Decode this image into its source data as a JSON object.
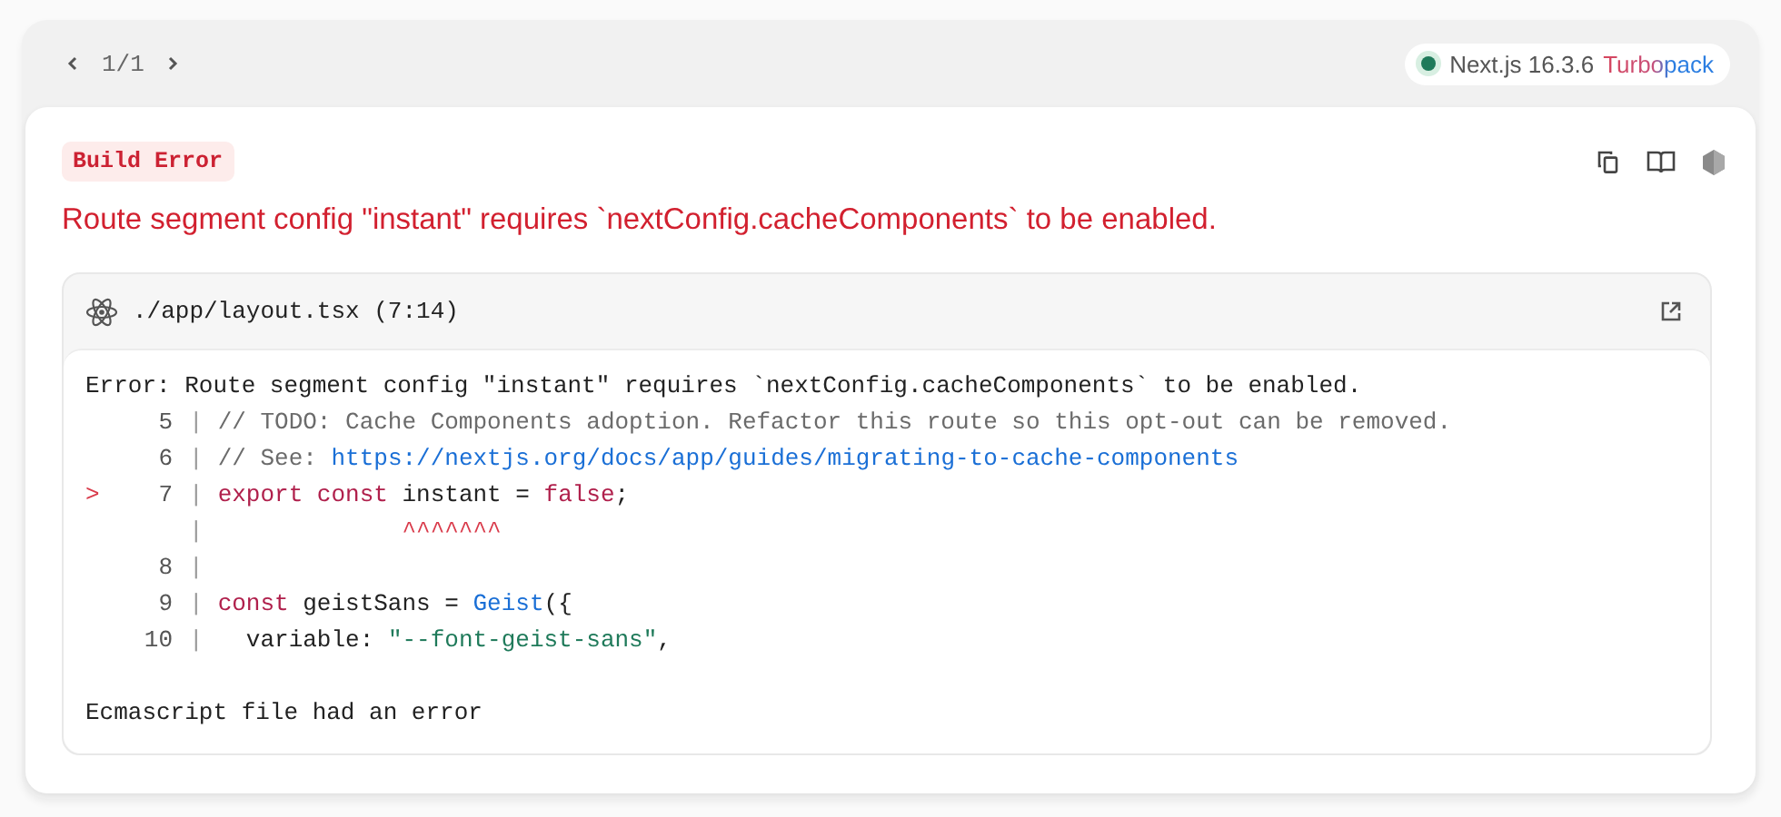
{
  "pager": {
    "label": "1/1",
    "prev_disabled": false,
    "next_disabled": false
  },
  "version_badge": {
    "version": "Next.js 16.3.6",
    "bundler": "Turbopack"
  },
  "error": {
    "badge": "Build Error",
    "title": "Route segment config \"instant\" requires `nextConfig.cacheComponents` to be enabled."
  },
  "code_frame": {
    "file": "./app/layout.tsx (7:14)",
    "message": "Error: Route segment config \"instant\" requires `nextConfig.cacheComponents` to be enabled.",
    "lines": [
      {
        "number": "5",
        "separator": "|",
        "tokens": [
          {
            "kind": "comment",
            "text": "// TODO: Cache Components adoption. Refactor this route so this opt-out can be removed."
          }
        ]
      },
      {
        "number": "6",
        "separator": "|",
        "tokens": [
          {
            "kind": "comment",
            "text": "// See: "
          },
          {
            "kind": "link",
            "text": "https://nextjs.org/docs/app/guides/migrating-to-cache-components"
          }
        ]
      },
      {
        "marker": ">",
        "number": "7",
        "separator": "|",
        "tokens": [
          {
            "kind": "keyword",
            "text": "export const"
          },
          {
            "kind": "plain",
            "text": " instant = "
          },
          {
            "kind": "keyword",
            "text": "false"
          },
          {
            "kind": "plain",
            "text": ";"
          }
        ]
      },
      {
        "separator": "|",
        "tokens": [
          {
            "kind": "caret",
            "text": "             ^^^^^^^"
          }
        ]
      },
      {
        "number": "8",
        "separator": "|"
      },
      {
        "number": "9",
        "separator": "|",
        "tokens": [
          {
            "kind": "keyword",
            "text": "const"
          },
          {
            "kind": "plain",
            "text": " geistSans = "
          },
          {
            "kind": "function",
            "text": "Geist"
          },
          {
            "kind": "plain",
            "text": "({"
          }
        ]
      },
      {
        "number": "10",
        "separator": "|",
        "tokens": [
          {
            "kind": "plain",
            "text": "  variable: "
          },
          {
            "kind": "string",
            "text": "\"--font-geist-sans\""
          },
          {
            "kind": "plain",
            "text": ","
          }
        ]
      }
    ],
    "footer": "Ecmascript file had an error"
  }
}
